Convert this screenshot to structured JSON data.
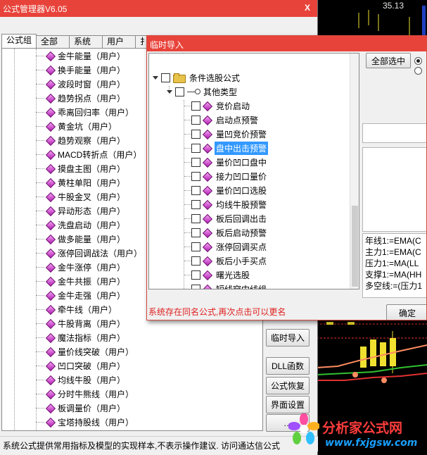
{
  "chart_bg": {
    "price_label": "35.13"
  },
  "main_window": {
    "title": "公式管理器V6.05",
    "close_label": "X",
    "tabs": [
      "公式组",
      "全部",
      "系统",
      "用户",
      "扌"
    ],
    "tree_items": [
      "金牛能量（用户）",
      "换手能量（用户）",
      "波段时窗（用户）",
      "趋势拐点（用户）",
      "乖离回归率（用户）",
      "黄金坑（用户）",
      "趋势观察（用户）",
      "MACD转折点（用户）",
      "摸盘主图（用户）",
      "黄柱单阳（用户）",
      "牛股金叉（用户）",
      "异动形态（用户）",
      "洗盘启动（用户）",
      "做多能量（用户）",
      "涨停回调战法（用户）",
      "金牛涨停（用户）",
      "金牛共振（用户）",
      "金牛走强（用户）",
      "牵牛线（用户）",
      "牛股背离（用户）",
      "魔法指标（用户）",
      "量价线突破（用户）",
      "凹口突破（用户）",
      "均线牛股（用户）",
      "分时牛熊线（用户）",
      "板调量价（用户）",
      "宝塔持股线（用户）"
    ],
    "buttons": {
      "import": "临时导入",
      "dll": "DLL函数",
      "restore": "公式恢复",
      "ui_settings": "界面设置",
      "hidden": "…"
    },
    "status_text": "系统公式提供常用指标及模型的实现样本,不表示操作建议.    访问通达信公式"
  },
  "import_dialog": {
    "title": "临时导入",
    "root_label": "条件选股公式",
    "group_label": "其他类型",
    "items": [
      "竞价启动",
      "启动点预警",
      "量凹竞价预警",
      "盘中出击预警",
      "量价凹口盘中",
      "接力凹口量价",
      "量价凹口选股",
      "均线牛股预警",
      "板后回调出击",
      "板后启动预警",
      "涨停回调买点",
      "板后小手买点",
      "曙光选股",
      "短线穿中线组",
      "某日涨停股"
    ],
    "selected_item": "盘中出击预警",
    "select_all_label": "全部选中",
    "formula_lines": [
      "年线1:=EMA(C",
      "主力1:=EMA(C",
      "压力1:=MA(LL",
      "支撑1:=MA(HH",
      "多空线:=(压力1"
    ],
    "confirm_label": "确定",
    "message": "系统存在同名公式,再次点击可以更名"
  },
  "watermark": {
    "name": "分析家公式网",
    "url": "www.fxjgsw.com"
  }
}
